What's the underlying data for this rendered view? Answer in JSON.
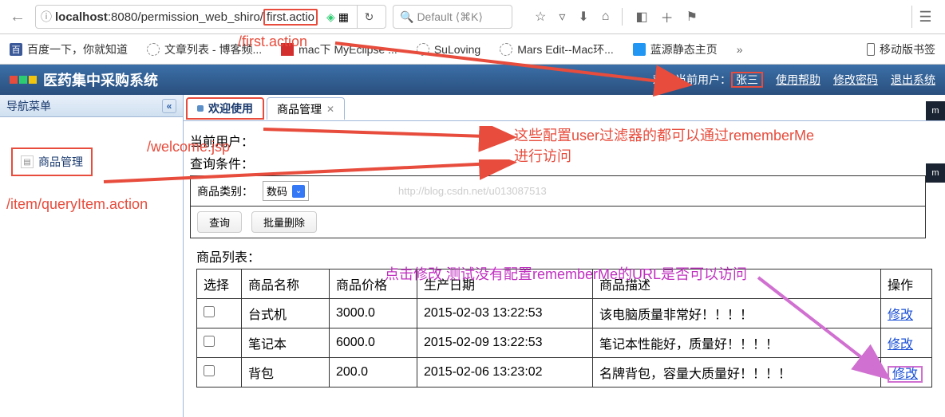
{
  "browser": {
    "url_prefix": "localhost",
    "url_port": ":8080/permission_web_shiro/",
    "url_page": "first.actio",
    "search_placeholder": "Default ⟨⌘K⟩"
  },
  "bookmarks": [
    {
      "label": "百度一下，你就知道"
    },
    {
      "label": "文章列表 - 博客频..."
    },
    {
      "label": "mac下 MyEclipse ..."
    },
    {
      "label": "SuLoving"
    },
    {
      "label": "Mars Edit--Mac环..."
    },
    {
      "label": "蓝源静态主页"
    },
    {
      "label": "移动版书签"
    }
  ],
  "header": {
    "app_title": "医药集中采购系统",
    "welcome_prefix": "欢迎当前用户：",
    "username": "张三",
    "help": "使用帮助",
    "change_pwd": "修改密码",
    "logout": "退出系统"
  },
  "sidebar": {
    "title": "导航菜单",
    "item": "商品管理"
  },
  "tabs": [
    {
      "label": "欢迎使用",
      "closable": false
    },
    {
      "label": "商品管理",
      "closable": true
    }
  ],
  "form": {
    "current_user_label": "当前用户：",
    "query_cond_label": "查询条件：",
    "category_label": "商品类别：",
    "category_value": "数码",
    "query_btn": "查询",
    "batch_del_btn": "批量删除",
    "watermark": "http://blog.csdn.net/u013087513",
    "list_title": "商品列表："
  },
  "table": {
    "headers": [
      "选择",
      "商品名称",
      "商品价格",
      "生产日期",
      "商品描述",
      "操作"
    ],
    "rows": [
      {
        "name": "台式机",
        "price": "3000.0",
        "date": "2015-02-03 13:22:53",
        "desc": "该电脑质量非常好！！！！",
        "action": "修改"
      },
      {
        "name": "笔记本",
        "price": "6000.0",
        "date": "2015-02-09 13:22:53",
        "desc": "笔记本性能好，质量好！！！！",
        "action": "修改"
      },
      {
        "name": "背包",
        "price": "200.0",
        "date": "2015-02-06 13:23:02",
        "desc": "名牌背包，容量大质量好！！！！",
        "action": "修改"
      }
    ]
  },
  "annotations": {
    "first_action": "/first.action",
    "welcome_jsp": "/welcome.jsp",
    "query_item": "/item/queryItem.action",
    "filter_note1": "这些配置user过滤器的都可以通过rememberMe",
    "filter_note2": "进行访问",
    "click_note": "点击修改 测试没有配置rememberMe的URL是否可以访问"
  }
}
